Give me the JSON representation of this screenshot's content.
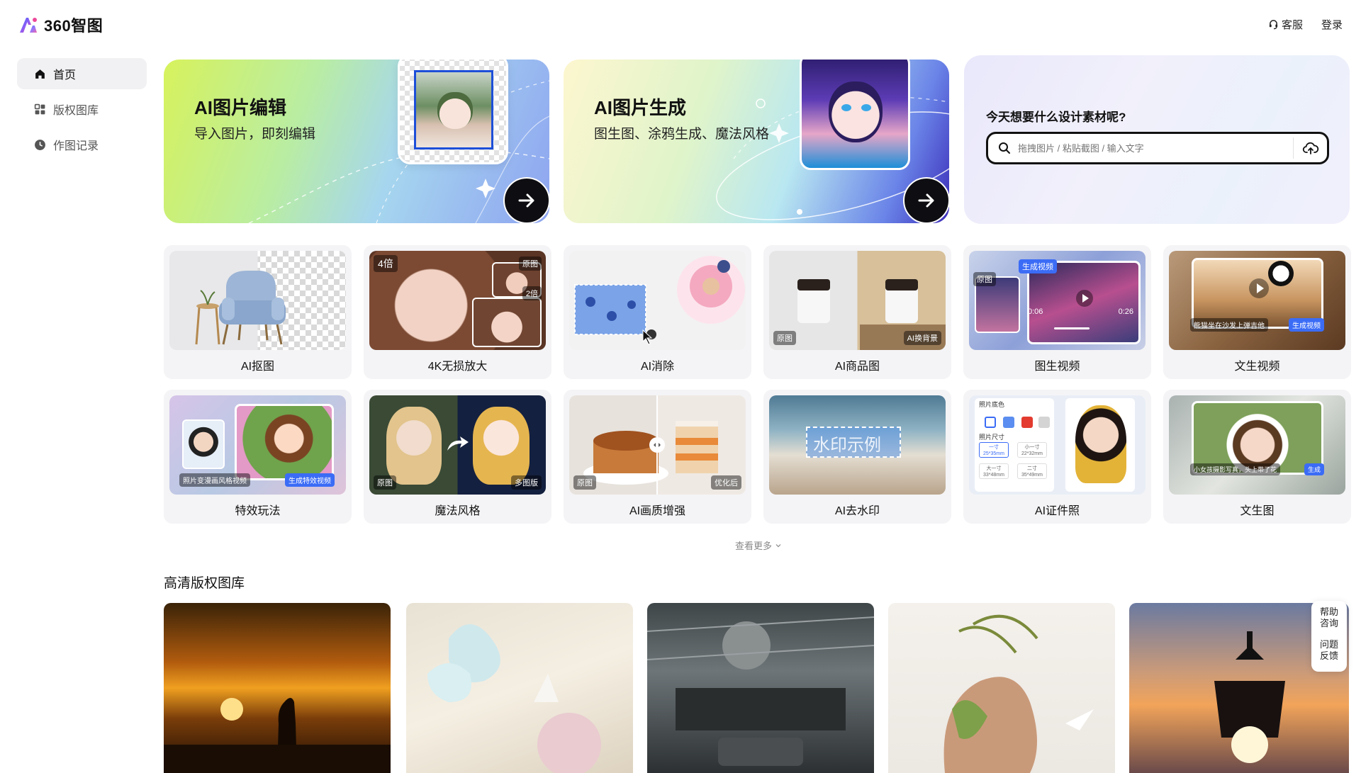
{
  "header": {
    "logo_text": "360智图",
    "service_label": "客服",
    "login_label": "登录"
  },
  "sidebar": {
    "items": [
      {
        "label": "首页",
        "icon": "home-icon",
        "active": true
      },
      {
        "label": "版权图库",
        "icon": "grid-icon",
        "active": false
      },
      {
        "label": "作图记录",
        "icon": "clock-icon",
        "active": false
      }
    ]
  },
  "banners": {
    "edit": {
      "title": "AI图片编辑",
      "subtitle": "导入图片，即刻编辑"
    },
    "generate": {
      "title": "AI图片生成",
      "subtitle": "图生图、涂鸦生成、魔法风格"
    },
    "search": {
      "title": "今天想要什么设计素材呢?",
      "placeholder": "拖拽图片 / 粘贴截图 / 输入文字"
    }
  },
  "tools": [
    {
      "label": "AI抠图"
    },
    {
      "label": "4K无损放大",
      "tags": [
        "4倍",
        "原图",
        "2倍"
      ]
    },
    {
      "label": "AI消除"
    },
    {
      "label": "AI商品图",
      "tags": [
        "原图",
        "AI换背景"
      ]
    },
    {
      "label": "图生视频",
      "tags": [
        "原图",
        "生成视频",
        "0:06",
        "0:26"
      ]
    },
    {
      "label": "文生视频",
      "tags": [
        "熊猫坐在沙发上弹吉他",
        "生成视频"
      ]
    },
    {
      "label": "特效玩法",
      "tags": [
        "照片变漫画风格视频",
        "生成特效视频"
      ]
    },
    {
      "label": "魔法风格",
      "tags": [
        "原图",
        "多图版"
      ]
    },
    {
      "label": "AI画质增强",
      "tags": [
        "原图",
        "优化后"
      ]
    },
    {
      "label": "AI去水印",
      "tags": [
        "水印示例"
      ]
    },
    {
      "label": "AI证件照",
      "tags": [
        "照片底色",
        "照片尺寸",
        "一寸",
        "25*35mm",
        "小一寸",
        "22*32mm",
        "大一寸",
        "33*48mm",
        "二寸",
        "35*49mm"
      ]
    },
    {
      "label": "文生图",
      "tags": [
        "小女孩摄影写真，头上带了花",
        "生成"
      ]
    }
  ],
  "more_label": "查看更多",
  "gallery_title": "高清版权图库",
  "help": {
    "consult": "帮助咨询",
    "feedback": "问题反馈"
  },
  "colors": {
    "accent": "#1d4fd8",
    "dark": "#0e0e12",
    "card_bg": "#f4f4f6"
  }
}
